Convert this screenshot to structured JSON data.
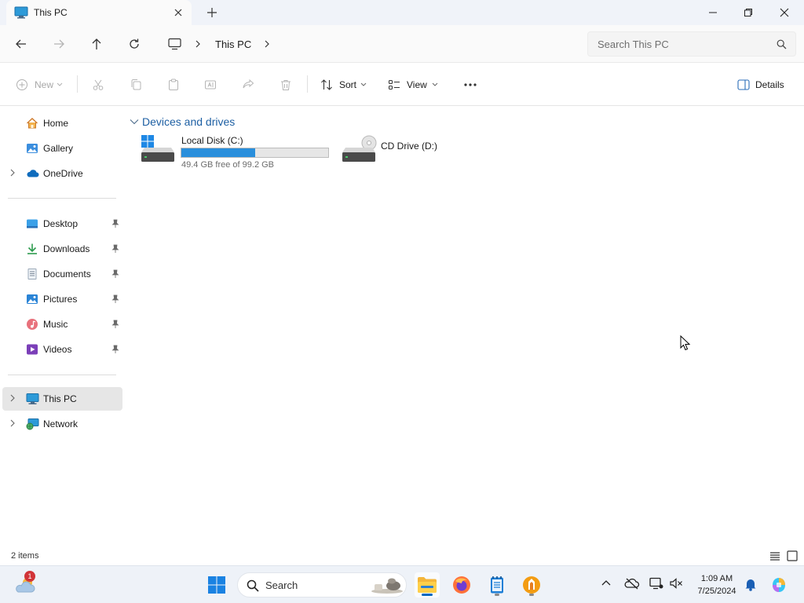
{
  "window": {
    "tab_title": "This PC",
    "tab_icon": "monitor-icon",
    "controls": [
      "minimize-icon",
      "maximize-icon",
      "close-icon"
    ]
  },
  "address": {
    "breadcrumb": "This PC",
    "search_placeholder": "Search This PC"
  },
  "toolbar": {
    "new_label": "New",
    "sort_label": "Sort",
    "view_label": "View",
    "details_label": "Details",
    "disabled_icons": [
      "cut-icon",
      "copy-icon",
      "paste-icon",
      "rename-icon",
      "share-icon",
      "delete-icon"
    ]
  },
  "sidebar": {
    "top": [
      {
        "label": "Home",
        "icon": "home-icon"
      },
      {
        "label": "Gallery",
        "icon": "gallery-icon"
      },
      {
        "label": "OneDrive",
        "icon": "onedrive-icon"
      }
    ],
    "pinned": [
      {
        "label": "Desktop",
        "icon": "desktop-icon"
      },
      {
        "label": "Downloads",
        "icon": "downloads-icon"
      },
      {
        "label": "Documents",
        "icon": "documents-icon"
      },
      {
        "label": "Pictures",
        "icon": "pictures-icon"
      },
      {
        "label": "Music",
        "icon": "music-icon"
      },
      {
        "label": "Videos",
        "icon": "videos-icon"
      }
    ],
    "bottom": [
      {
        "label": "This PC",
        "icon": "this-pc-icon",
        "selected": true
      },
      {
        "label": "Network",
        "icon": "network-icon"
      }
    ]
  },
  "content": {
    "group_title": "Devices and drives",
    "drives": [
      {
        "name": "Local Disk (C:)",
        "free_text": "49.4 GB free of 99.2 GB",
        "used_fraction": 0.502
      },
      {
        "name": "CD Drive (D:)"
      }
    ]
  },
  "status": {
    "item_count": "2 items"
  },
  "taskbar": {
    "weather_badge": "1",
    "search_label": "Search",
    "time": "1:09 AM",
    "date": "7/25/2024"
  },
  "colors": {
    "accent": "#0067c0",
    "usage_fill": "#2a8fdc",
    "group_title": "#1d5fa3"
  }
}
